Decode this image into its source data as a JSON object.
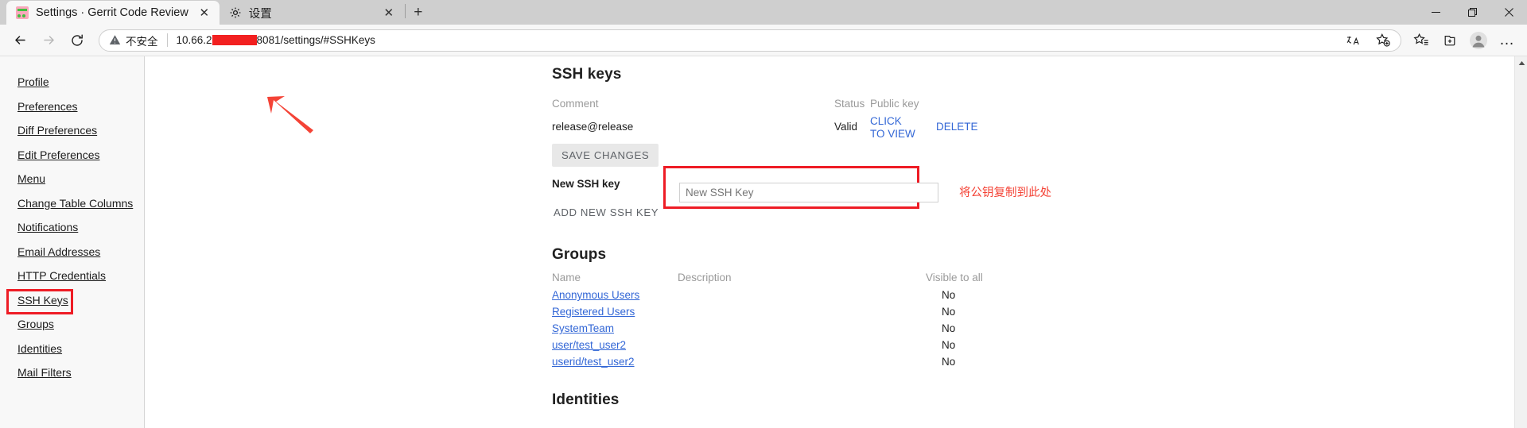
{
  "browser": {
    "tabs": [
      {
        "title": "Settings · Gerrit Code Review",
        "favicon": "gerrit-icon",
        "active": true,
        "close_label": "✕"
      },
      {
        "title": "设置",
        "favicon": "gear-icon",
        "active": false,
        "close_label": "✕"
      }
    ],
    "new_tab_label": "+",
    "window_controls": {
      "minimize": "—",
      "restore": "❐",
      "close": "✕"
    },
    "nav": {
      "back": "←",
      "forward": "→",
      "reload": "⟳"
    },
    "omnibox": {
      "security_label": "不安全",
      "url_prefix": "10.66.2",
      "url_suffix": "8081/settings/#SSHKeys",
      "redacted": true
    },
    "omnibox_actions": {
      "translate": "あ",
      "add_favorite": "favorite-add-icon"
    },
    "toolbar_actions": {
      "favorites": "favorites-icon",
      "collections": "collections-icon",
      "profile": "profile-icon",
      "settings_more": "…"
    }
  },
  "sidebar": {
    "items": [
      {
        "label": "Profile",
        "highlighted": false
      },
      {
        "label": "Preferences",
        "highlighted": false
      },
      {
        "label": "Diff Preferences",
        "highlighted": false
      },
      {
        "label": "Edit Preferences",
        "highlighted": false
      },
      {
        "label": "Menu",
        "highlighted": false
      },
      {
        "label": "Change Table Columns",
        "highlighted": false
      },
      {
        "label": "Notifications",
        "highlighted": false
      },
      {
        "label": "Email Addresses",
        "highlighted": false
      },
      {
        "label": "HTTP Credentials",
        "highlighted": false
      },
      {
        "label": "SSH Keys",
        "highlighted": true
      },
      {
        "label": "Groups",
        "highlighted": false
      },
      {
        "label": "Identities",
        "highlighted": false
      },
      {
        "label": "Mail Filters",
        "highlighted": false
      }
    ]
  },
  "ssh_keys": {
    "title": "SSH keys",
    "headers": {
      "comment": "Comment",
      "status": "Status",
      "public_key": "Public key"
    },
    "rows": [
      {
        "comment": "release@release",
        "status": "Valid",
        "view_label": "CLICK TO VIEW",
        "delete_label": "DELETE"
      }
    ],
    "save_label": "SAVE CHANGES",
    "new_key_label": "New SSH key",
    "new_key_placeholder": "New SSH Key",
    "new_key_value": "",
    "add_label": "ADD NEW SSH KEY"
  },
  "annotations": {
    "chinese_note": "将公钥复制到此处",
    "note_color": "#f44336",
    "box_color": "#ee1c25"
  },
  "groups": {
    "title": "Groups",
    "columns": [
      "Name",
      "Description",
      "Visible to all"
    ],
    "rows": [
      {
        "name": "Anonymous Users",
        "description": "",
        "visible": "No"
      },
      {
        "name": "Registered Users",
        "description": "",
        "visible": "No"
      },
      {
        "name": "SystemTeam",
        "description": "",
        "visible": "No"
      },
      {
        "name": "user/test_user2",
        "description": "",
        "visible": "No"
      },
      {
        "name": "userid/test_user2",
        "description": "",
        "visible": "No"
      }
    ]
  },
  "identities": {
    "title": "Identities"
  }
}
